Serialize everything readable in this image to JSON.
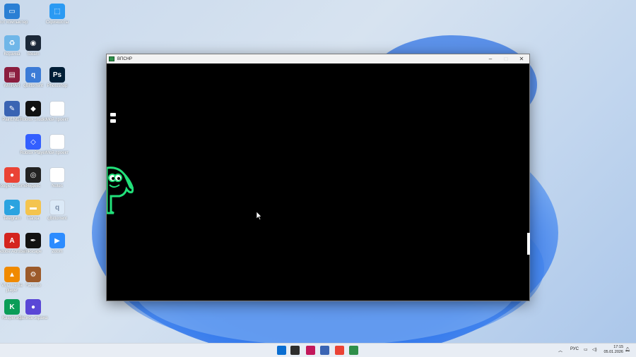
{
  "window": {
    "title": "ВПСНР",
    "minimize_glyph": "–",
    "maximize_glyph": "□",
    "close_glyph": "✕",
    "game": {
      "lives_remaining": 2,
      "creature_color": "#22e07a"
    }
  },
  "desktop_icons": [
    {
      "label": "Этот компьютер",
      "icon": "computer-icon",
      "color": "#2a7fd4"
    },
    {
      "label": "Скриншоты",
      "icon": "screenshot-icon",
      "color": "#2b9af3"
    },
    {
      "label": "Корзина",
      "icon": "recycle-bin-icon",
      "color": "#6fb6e8"
    },
    {
      "label": "Steam",
      "icon": "steam-icon",
      "color": "#1b2838"
    },
    {
      "label": "WinRAR",
      "icon": "winrar-icon",
      "color": "#8b1e3f"
    },
    {
      "label": "qBittorrent",
      "icon": "qbittorrent-icon",
      "color": "#3b7bd6"
    },
    {
      "label": "Photoshop",
      "icon": "photoshop-icon",
      "color": "#001e36"
    },
    {
      "label": "Paint.NET",
      "icon": "paintnet-icon",
      "color": "#3a64b3"
    },
    {
      "label": "Roblox Studio",
      "icon": "roblox-studio-icon",
      "color": "#111111"
    },
    {
      "label": "Мой проект",
      "icon": "file-icon",
      "color": "#ffffff"
    },
    {
      "label": "Roblox Player",
      "icon": "roblox-player-icon",
      "color": "#335fff"
    },
    {
      "label": "Мой проект",
      "icon": "file-icon",
      "color": "#ffffff"
    },
    {
      "label": "Google Chrome",
      "icon": "chrome-icon",
      "color": "#ea4335"
    },
    {
      "label": "Яндекс",
      "icon": "yandex-icon",
      "color": "#222222"
    },
    {
      "label": "Notes",
      "icon": "file-icon",
      "color": "#ffffff"
    },
    {
      "label": "Telegram",
      "icon": "telegram-icon",
      "color": "#2aa3e0"
    },
    {
      "label": "Папка",
      "icon": "folder-icon",
      "color": "#f4c44e"
    },
    {
      "label": "qBittorrent",
      "icon": "qbittorrent-icon",
      "color": "#dbe9f7"
    },
    {
      "label": "Adobe Acrobat",
      "icon": "acrobat-icon",
      "color": "#d4241f"
    },
    {
      "label": "Inkscape",
      "icon": "inkscape-icon",
      "color": "#111111"
    },
    {
      "label": "Zoom",
      "icon": "zoom-icon",
      "color": "#2d8cff"
    },
    {
      "label": "VLC media player",
      "icon": "vlc-icon",
      "color": "#f08a00"
    },
    {
      "label": "Factorio",
      "icon": "factorio-icon",
      "color": "#9c5a2a"
    },
    {
      "label": "Kaspersky",
      "icon": "kaspersky-icon",
      "color": "#0a9d58"
    },
    {
      "label": "Запись экрана",
      "icon": "screen-record-icon",
      "color": "#5a47d6"
    }
  ],
  "taskbar": {
    "apps": [
      {
        "name": "start-button",
        "icon": "windows-start-icon",
        "color": "#0a6ed1"
      },
      {
        "name": "file-explorer-button",
        "icon": "folder-icon",
        "color": "#2d2d2d"
      },
      {
        "name": "app-button-red",
        "icon": "app-icon",
        "color": "#c2185b"
      },
      {
        "name": "paint-button",
        "icon": "paintnet-icon",
        "color": "#3a64b3"
      },
      {
        "name": "chrome-button",
        "icon": "chrome-icon",
        "color": "#ea4335"
      },
      {
        "name": "game-window-button",
        "icon": "game-icon",
        "color": "#2f8f4a"
      }
    ],
    "language": "РУС",
    "time": "17:15",
    "date": "05.01.2026"
  }
}
